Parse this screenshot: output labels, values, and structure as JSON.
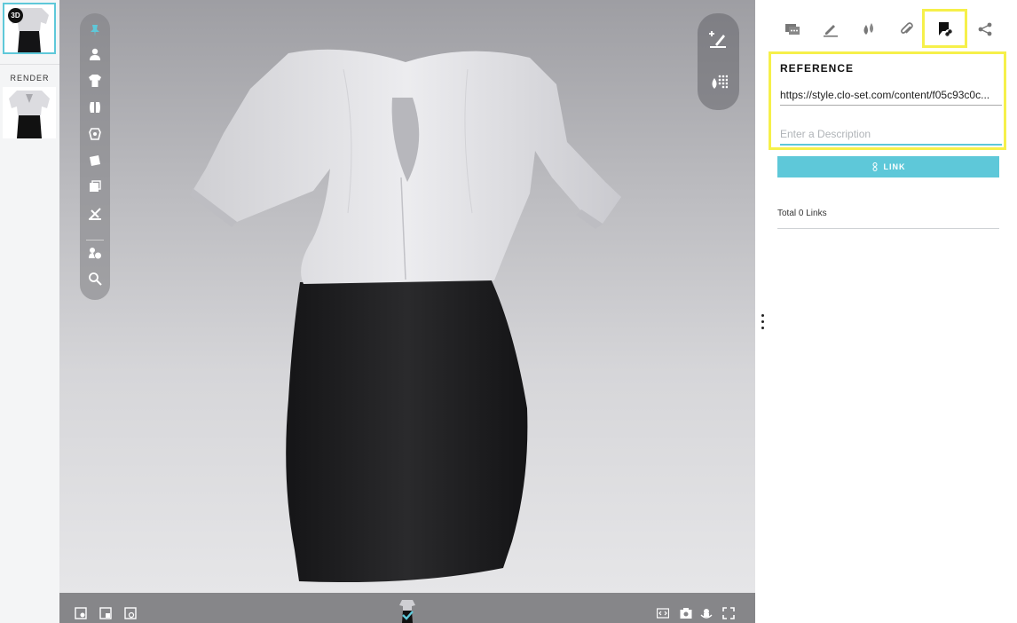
{
  "thumbnails": {
    "items": [
      {
        "label": "3D",
        "badge": "3D",
        "selected": true
      },
      {
        "label": "RENDER",
        "selected": false
      }
    ],
    "render_label": "RENDER"
  },
  "viewport": {
    "left_tools": [
      "pin-icon",
      "avatar-icon",
      "garment-icon",
      "pattern-icon",
      "fabric-icon",
      "texture-icon",
      "colorway-icon",
      "measure-icon",
      "avatar-settings-icon",
      "zoom-icon"
    ],
    "right_tools": [
      "add-annotation-icon",
      "color-picker-icon"
    ],
    "bottom_left_icons": [
      "viewport-settings-icon",
      "layout-icon",
      "snapshot-icon"
    ],
    "bottom_right_icons": [
      "embed-code-icon",
      "camera-icon",
      "turntable-icon",
      "fullscreen-icon"
    ]
  },
  "panel": {
    "tabs": [
      "comments-icon",
      "edit-icon",
      "colorway-drops-icon",
      "attachment-icon",
      "reference-link-icon",
      "share-icon"
    ],
    "active_tab": "reference-link-icon",
    "reference": {
      "title": "REFERENCE",
      "url_value": "https://style.clo-set.com/content/f05c93c0c...",
      "description_placeholder": "Enter a Description",
      "description_value": ""
    },
    "link_button_label": "LINK",
    "total_links_text": "Total 0 Links"
  },
  "colors": {
    "accent": "#5ec8d9",
    "highlight": "#f6f04a",
    "shirt": "#e4e4e7",
    "skirt": "#1f1f21"
  }
}
